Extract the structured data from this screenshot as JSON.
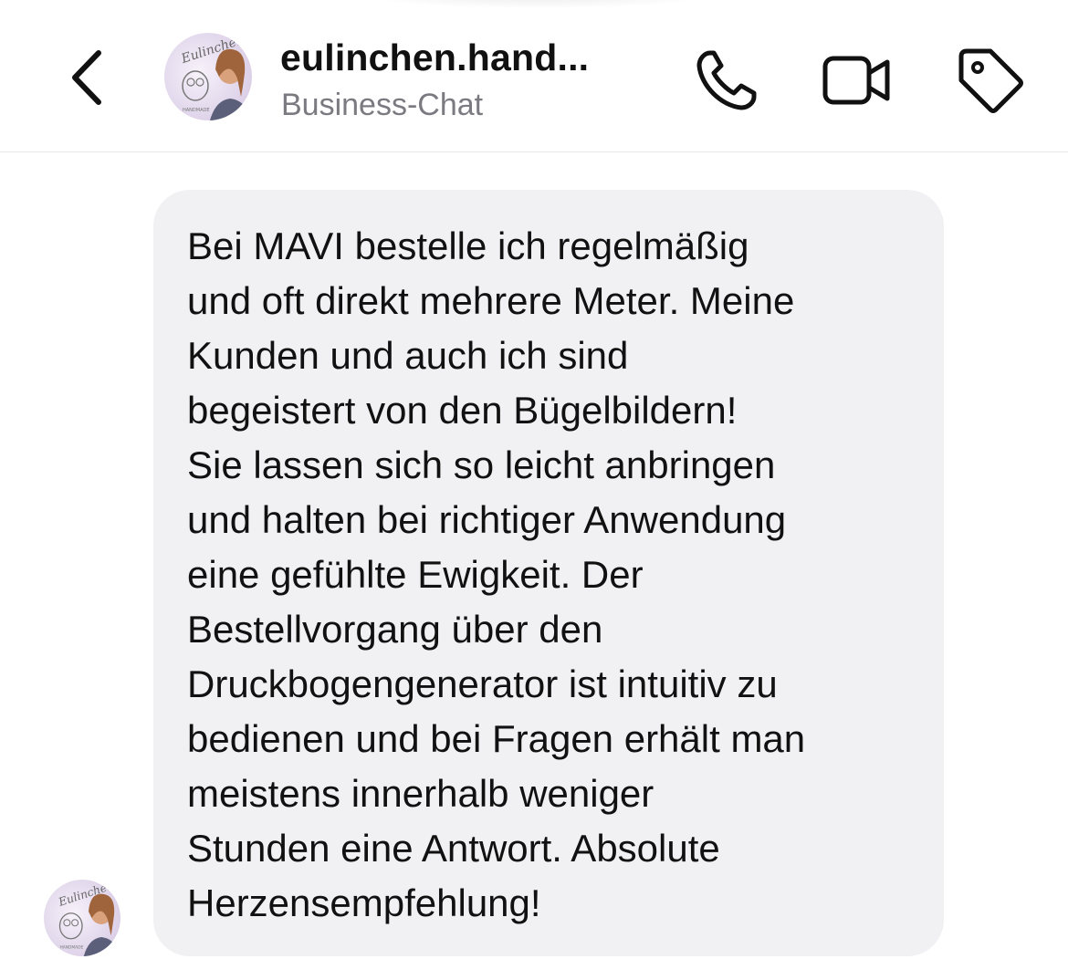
{
  "header": {
    "title": "eulinchen.hand...",
    "subtitle": "Business-Chat",
    "back_icon": "chevron-left-icon",
    "actions": [
      {
        "icon": "phone-icon"
      },
      {
        "icon": "video-camera-icon"
      },
      {
        "icon": "tag-icon"
      }
    ],
    "avatar_logo_text": "Eulinchen HANDMADE"
  },
  "message": {
    "lines": [
      "Bei MAVI bestelle ich regelmäßig",
      "und oft direkt mehrere Meter. Meine",
      "Kunden und auch ich sind",
      "begeistert von den Bügelbildern!",
      "Sie lassen sich so leicht anbringen",
      "und halten bei richtiger Anwendung",
      "eine gefühlte Ewigkeit. Der",
      "Bestellvorgang über den",
      "Druckbogengenerator ist intuitiv zu",
      "bedienen und bei Fragen erhält man",
      "meistens innerhalb weniger",
      "Stunden eine Antwort. Absolute",
      "Herzensempfehlung!"
    ]
  },
  "colors": {
    "bubble": "#f1f1f3",
    "text": "#111111",
    "subtitle": "#7a7a80"
  }
}
